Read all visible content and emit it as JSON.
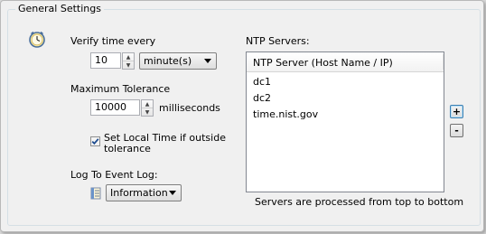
{
  "group": {
    "title": "General Settings"
  },
  "verify": {
    "label": "Verify time every",
    "value": "10",
    "unit_selected": "minute(s)"
  },
  "tolerance": {
    "label": "Maximum Tolerance",
    "value": "10000",
    "unit_label": "milliseconds"
  },
  "set_local": {
    "checked": true,
    "label_line1": "Set Local Time if outside",
    "label_line2": "tolerance"
  },
  "event_log": {
    "label": "Log To Event Log:",
    "selected": "Information"
  },
  "ntp": {
    "label": "NTP Servers:",
    "column_header": "NTP Server (Host Name / IP)",
    "servers": [
      "dc1",
      "dc2",
      "time.nist.gov"
    ],
    "footer": "Servers are processed from top to bottom",
    "add_label": "+",
    "remove_label": "-"
  },
  "icons": {
    "clock": "clock-icon",
    "event_log": "event-log-icon",
    "spinner_up": "spinner-up-icon",
    "spinner_down": "spinner-down-icon",
    "dropdown": "chevron-down-icon",
    "check": "check-icon"
  },
  "colors": {
    "panel_background": "#f0f0f0",
    "group_border": "#d5dfe5",
    "clock_face": "#f4e49a",
    "focus_border": "#3c7fb1"
  }
}
